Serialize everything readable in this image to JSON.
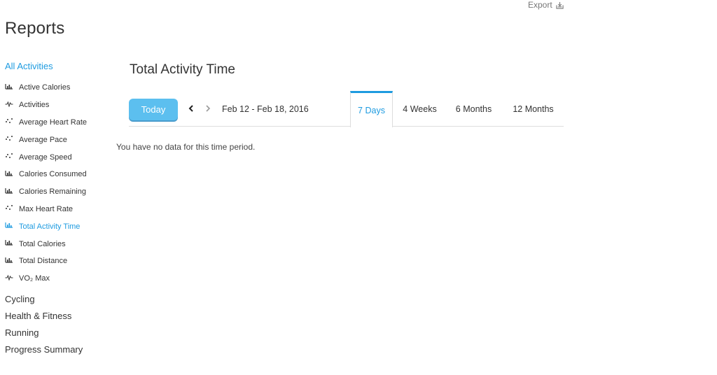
{
  "header": {
    "export_label": "Export",
    "export_icon": "export-icon"
  },
  "page_title": "Reports",
  "sidebar": {
    "active_category": "All Activities",
    "sub_items": [
      {
        "label": "Active Calories",
        "icon": "bar-chart-icon",
        "active": false
      },
      {
        "label": "Activities",
        "icon": "line-chart-icon",
        "active": false
      },
      {
        "label": "Average Heart Rate",
        "icon": "scatter-chart-icon",
        "active": false
      },
      {
        "label": "Average Pace",
        "icon": "scatter-chart-icon",
        "active": false
      },
      {
        "label": "Average Speed",
        "icon": "scatter-chart-icon",
        "active": false
      },
      {
        "label": "Calories Consumed",
        "icon": "bar-chart-icon",
        "active": false
      },
      {
        "label": "Calories Remaining",
        "icon": "bar-chart-icon",
        "active": false
      },
      {
        "label": "Max Heart Rate",
        "icon": "scatter-chart-icon",
        "active": false
      },
      {
        "label": "Total Activity Time",
        "icon": "bar-chart-icon",
        "active": true
      },
      {
        "label": "Total Calories",
        "icon": "bar-chart-icon",
        "active": false
      },
      {
        "label": "Total Distance",
        "icon": "bar-chart-icon",
        "active": false
      },
      {
        "label": "VO₂ Max",
        "icon": "line-chart-icon",
        "active": false
      }
    ],
    "categories": [
      "Cycling",
      "Health & Fitness",
      "Running",
      "Progress Summary"
    ]
  },
  "report": {
    "title": "Total Activity Time",
    "today_label": "Today",
    "date_range": "Feb 12 - Feb 18, 2016",
    "tabs": [
      {
        "label": "7 Days",
        "active": true
      },
      {
        "label": "4 Weeks",
        "active": false
      },
      {
        "label": "6 Months",
        "active": false
      },
      {
        "label": "12 Months",
        "active": false
      }
    ],
    "empty_message": "You have no data for this time period."
  },
  "colors": {
    "accent": "#1e9be0",
    "button": "#5cbfef",
    "text": "#333333"
  }
}
